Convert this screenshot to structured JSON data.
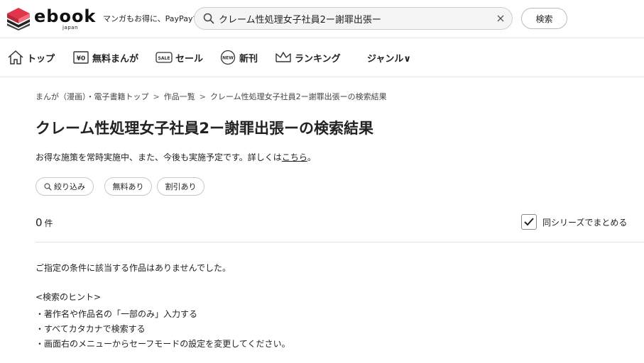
{
  "header": {
    "logo_text": "ebook",
    "logo_sub": "japan",
    "tagline": "マンガもお得に、PayPayで",
    "search_value": "クレーム性処理女子社員2ー謝罪出張ー",
    "search_button": "検索"
  },
  "nav": {
    "items": [
      {
        "label": "トップ",
        "icon": "home-icon"
      },
      {
        "label": "無料まんが",
        "icon": "free-yen-icon"
      },
      {
        "label": "セール",
        "icon": "sale-tag-icon"
      },
      {
        "label": "新刊",
        "icon": "new-badge-icon"
      },
      {
        "label": "ランキング",
        "icon": "crown-icon"
      },
      {
        "label": "ジャンル∨",
        "icon": ""
      }
    ]
  },
  "breadcrumb": [
    "まんが（漫画）・電子書籍トップ",
    "作品一覧",
    "クレーム性処理女子社員2ー謝罪出張ーの検索結果"
  ],
  "breadcrumb_sep": ">",
  "title": {
    "keyword": "クレーム性処理女子社員2ー謝罪出張ー",
    "suffix": "の検索結果"
  },
  "notice": {
    "text": "お得な施策を常時実施中、また、今後も実施予定です。詳しくは",
    "link": "こちら",
    "end": "。"
  },
  "filters": {
    "narrow": "絞り込み",
    "free": "無料あり",
    "discount": "割引あり"
  },
  "results": {
    "count": "0",
    "unit": "件",
    "series_toggle": "同シリーズでまとめる",
    "series_checked": true
  },
  "empty": {
    "message": "ご指定の条件に該当する作品はありませんでした。",
    "hint_title": "<検索のヒント>",
    "hints": [
      "・著作名や作品名の「一部のみ」入力する",
      "・すべてカタカナで検索する",
      "・画面右のメニューからセーフモードの設定を変更してください。"
    ]
  },
  "colors": {
    "brand": "#e3344b",
    "text": "#222222",
    "border": "#c8c8c8"
  }
}
